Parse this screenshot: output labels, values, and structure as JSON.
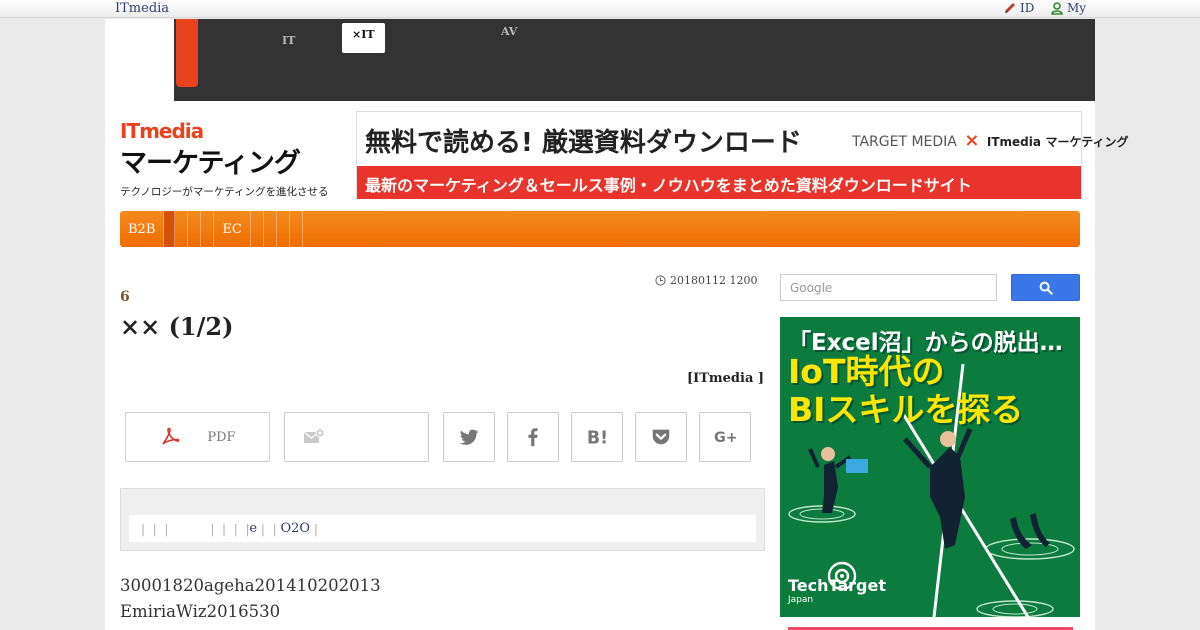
{
  "topbar": {
    "brand": "ITmedia",
    "id_link": "ID",
    "my_link": "My"
  },
  "darknav": {
    "items": [
      {
        "line1": "",
        "line2": "IT"
      },
      {
        "line1": "",
        "line2": "×IT"
      },
      {
        "line1": "AV",
        "line2": ""
      }
    ]
  },
  "header": {
    "logo_top": "ITmedia",
    "logo_main": "マーケティング",
    "logo_tagline": "テクノロジーがマーケティングを進化させる"
  },
  "banner": {
    "headline": "無料で読める! 厳選資料ダウンロード",
    "partner": "TARGET MEDIA",
    "times": "×",
    "partner2_top": "ITmedia",
    "partner2_main": "マーケティング",
    "strip": "最新のマーケティング＆セールス事例・ノウハウをまとめた資料ダウンロードサイト"
  },
  "catnav": {
    "first": "B2B",
    "ec": "EC"
  },
  "article": {
    "dateline": "20180112 1200",
    "kicker": "6",
    "title": "×× (1/2)",
    "byline": "[ITmedia ]",
    "pdf_label": "PDF",
    "tags_prefix": "|  |  |           |  |  |  |",
    "tag_e": "e",
    "tag_o2o": "O2O",
    "body_line1": "30001820ageha201410202013",
    "body_line2": "EmiriaWiz2016530"
  },
  "sidebar": {
    "search_placeholder": "Google",
    "ad_line1": "「Excel沼」からの脱出…",
    "ad_line2": "IoT時代の",
    "ad_line3": "BIスキルを探る",
    "ad_brand": "TechTarget",
    "ad_brand_sub": "Japan"
  },
  "colors": {
    "accent_orange": "#ef6c00",
    "nav_dark": "#333333",
    "search_blue": "#3b78e7",
    "ad_green": "#0c7b3e"
  }
}
